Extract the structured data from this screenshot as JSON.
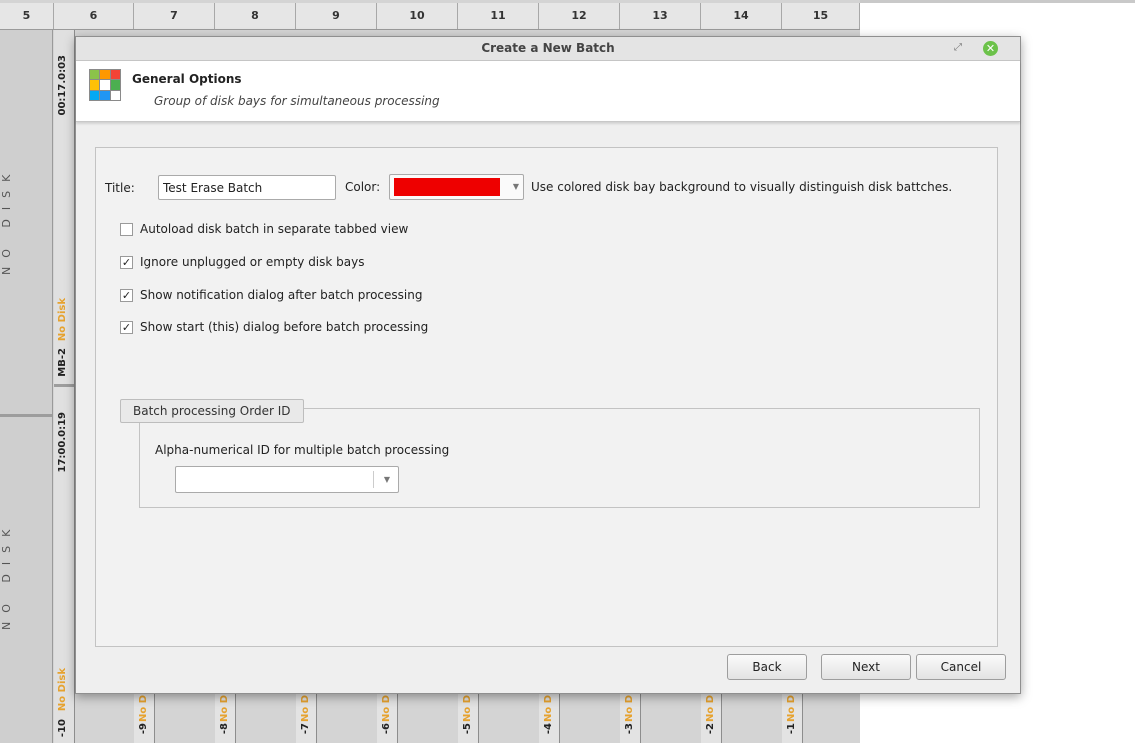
{
  "background_app": {
    "column_headers": [
      "5",
      "6",
      "7",
      "8",
      "9",
      "10",
      "11",
      "12",
      "13",
      "14",
      "15"
    ],
    "left_panel": {
      "upper_label": "NO DISK",
      "lower_label": "NO DISK"
    },
    "bay_upper": {
      "timer": "00:17.0:03",
      "status": "No Disk",
      "id": "MB-2"
    },
    "bay_lower": {
      "timer": "17:00.0:19",
      "status": "No Disk",
      "id": "-10"
    },
    "bottom_bays": [
      {
        "status": "No D",
        "id": "-9"
      },
      {
        "status": "No D",
        "id": "-8"
      },
      {
        "status": "No D",
        "id": "-7"
      },
      {
        "status": "No D",
        "id": "-6"
      },
      {
        "status": "No D",
        "id": "-5"
      },
      {
        "status": "No D",
        "id": "-4"
      },
      {
        "status": "No D",
        "id": "-3"
      },
      {
        "status": "No D",
        "id": "-2"
      },
      {
        "status": "No D",
        "id": "-1"
      }
    ],
    "status_color": "#e6a22e"
  },
  "dialog": {
    "title": "Create a New Batch",
    "header": {
      "title": "General Options",
      "subtitle": "Group of disk bays for simultaneous processing",
      "icon": "grid-table-icon"
    },
    "form": {
      "title_label": "Title:",
      "title_value": "Test Erase Batch",
      "color_label": "Color:",
      "color_value": "#ee0000",
      "color_hint": "Use colored disk bay background to visually distinguish disk battches.",
      "options": [
        {
          "label": "Autoload disk batch in separate tabbed view",
          "checked": false
        },
        {
          "label": "Ignore unplugged or empty disk bays",
          "checked": true
        },
        {
          "label": "Show notification dialog after batch processing",
          "checked": true
        },
        {
          "label": "Show start (this) dialog before batch processing",
          "checked": true
        }
      ]
    },
    "order_group": {
      "title": "Batch processing Order ID",
      "field_label": "Alpha-numerical ID for multiple batch processing",
      "value": ""
    },
    "buttons": {
      "back": "Back",
      "next": "Next",
      "cancel": "Cancel"
    }
  }
}
